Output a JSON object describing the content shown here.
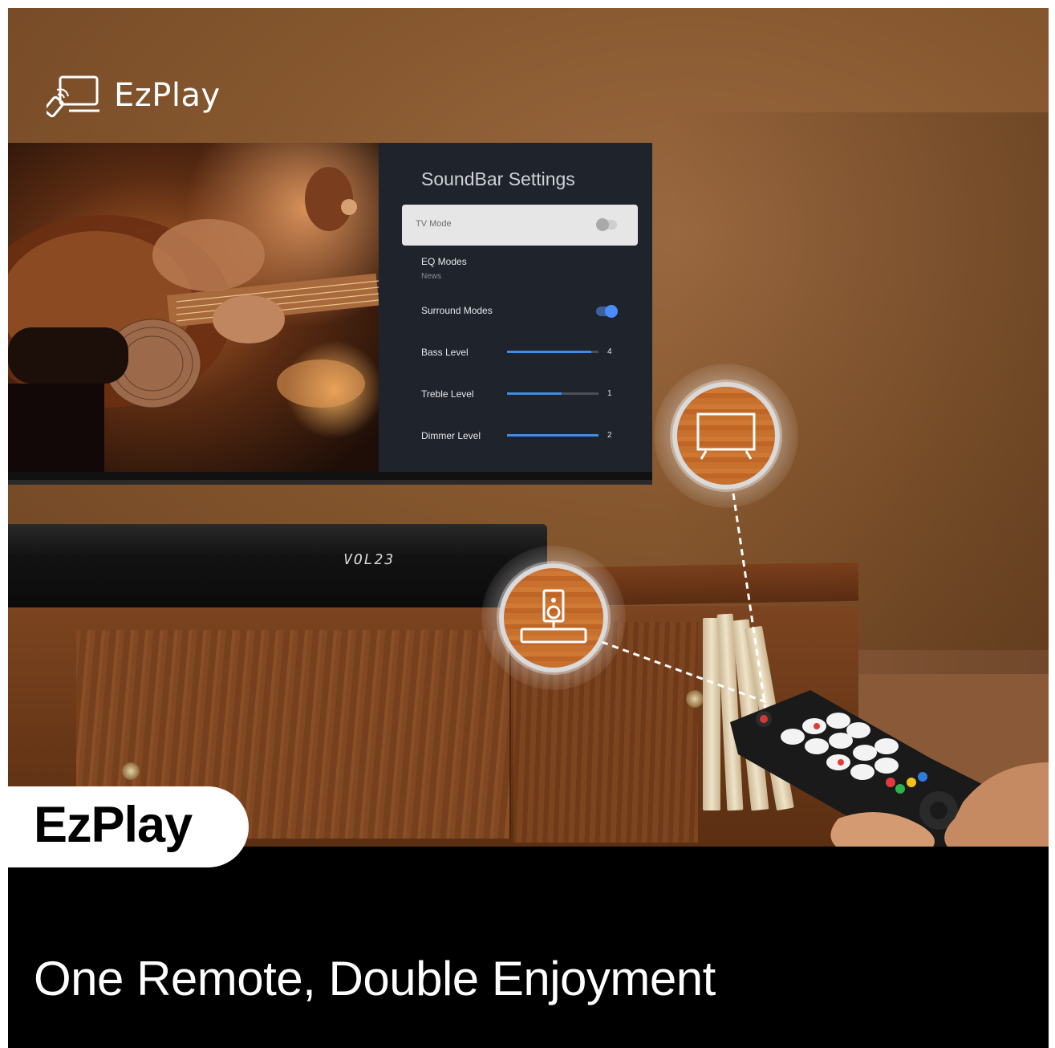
{
  "brand": {
    "name": "EzPlay",
    "icon": "cast-to-tv-icon"
  },
  "soundbar_settings": {
    "title": "SoundBar Settings",
    "tv_mode": {
      "label": "TV Mode",
      "enabled": false
    },
    "eq_modes": {
      "label": "EQ Modes",
      "value": "News"
    },
    "surround_modes": {
      "label": "Surround Modes",
      "enabled": true
    },
    "sliders": [
      {
        "label": "Bass Level",
        "value": "4",
        "fill": 0.92
      },
      {
        "label": "Treble Level",
        "value": "1",
        "fill": 0.6
      },
      {
        "label": "Dimmer Level",
        "value": "2",
        "fill": 1.0
      }
    ]
  },
  "soundbar": {
    "display": "VOL23"
  },
  "callouts": [
    {
      "icon": "tv-icon"
    },
    {
      "icon": "soundbar-speaker-icon"
    }
  ],
  "badge": {
    "label": "EzPlay"
  },
  "tagline": "One Remote, Double Enjoyment",
  "colors": {
    "accent_blue": "#3d8ee8",
    "panel_bg": "#1f232b",
    "callout_orange": "#c8702d"
  }
}
